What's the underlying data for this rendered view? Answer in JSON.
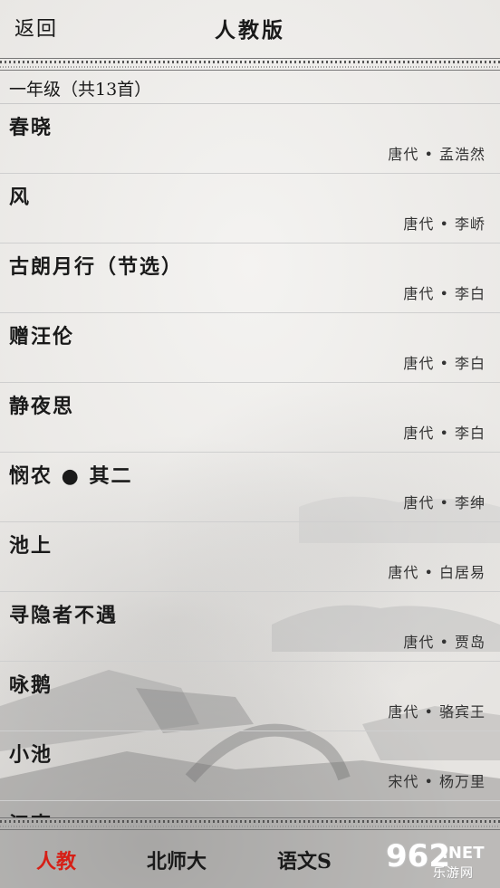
{
  "header": {
    "back_label": "返回",
    "title": "人教版"
  },
  "section": {
    "title": "一年级（共13首）"
  },
  "poems": [
    {
      "name": "春晓",
      "meta": "唐代 • 孟浩然"
    },
    {
      "name": "风",
      "meta": "唐代 • 李峤"
    },
    {
      "name": "古朗月行（节选）",
      "meta": "唐代 • 李白"
    },
    {
      "name": "赠汪伦",
      "meta": "唐代 • 李白"
    },
    {
      "name": "静夜思",
      "meta": "唐代 • 李白"
    },
    {
      "name": "悯农 ● 其二",
      "meta": "唐代 • 李绅"
    },
    {
      "name": "池上",
      "meta": "唐代 • 白居易"
    },
    {
      "name": "寻隐者不遇",
      "meta": "唐代 • 贾岛"
    },
    {
      "name": "咏鹅",
      "meta": "唐代 • 骆宾王"
    },
    {
      "name": "小池",
      "meta": "宋代 • 杨万里"
    },
    {
      "name": "江南",
      "meta": ""
    }
  ],
  "tabs": [
    {
      "label": "人教",
      "active": true
    },
    {
      "label": "北师大",
      "active": false
    },
    {
      "label": "语文S",
      "active": false
    }
  ],
  "watermark": {
    "number": "962",
    "suffix": ".NET",
    "site": "乐游网"
  },
  "colors": {
    "active_tab": "#d61f16",
    "background": "#eeecea"
  }
}
